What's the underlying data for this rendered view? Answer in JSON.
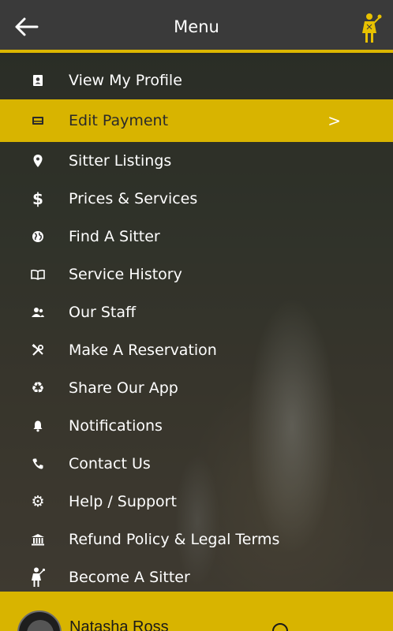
{
  "header": {
    "title": "Menu",
    "back_icon": "back-arrow-icon",
    "logo_icon": "sitter-logo-icon"
  },
  "menu": {
    "items": [
      {
        "label": "View My Profile",
        "icon": "profile-card-icon"
      },
      {
        "label": "Edit Payment",
        "icon": "payment-card-icon",
        "active": true,
        "arrow": ">"
      },
      {
        "label": "Sitter Listings",
        "icon": "location-pin-icon"
      },
      {
        "label": "Prices & Services",
        "icon": "dollar-icon"
      },
      {
        "label": "Find A Sitter",
        "icon": "globe-icon"
      },
      {
        "label": "Service History",
        "icon": "book-icon"
      },
      {
        "label": "Our Staff",
        "icon": "staff-icon"
      },
      {
        "label": "Make A Reservation",
        "icon": "tools-icon"
      },
      {
        "label": "Share Our App",
        "icon": "recycle-icon"
      },
      {
        "label": "Notifications",
        "icon": "bell-icon"
      },
      {
        "label": "Contact Us",
        "icon": "phone-icon"
      },
      {
        "label": "Help / Support",
        "icon": "gear-icon"
      },
      {
        "label": "Refund Policy & Legal Terms",
        "icon": "bank-icon"
      },
      {
        "label": "Become A Sitter",
        "icon": "sitter-icon"
      }
    ]
  },
  "footer": {
    "user_name": "Natasha Ross"
  },
  "colors": {
    "accent": "#d8b400",
    "header_bg": "#3a3a3a",
    "text": "#ffffff"
  }
}
